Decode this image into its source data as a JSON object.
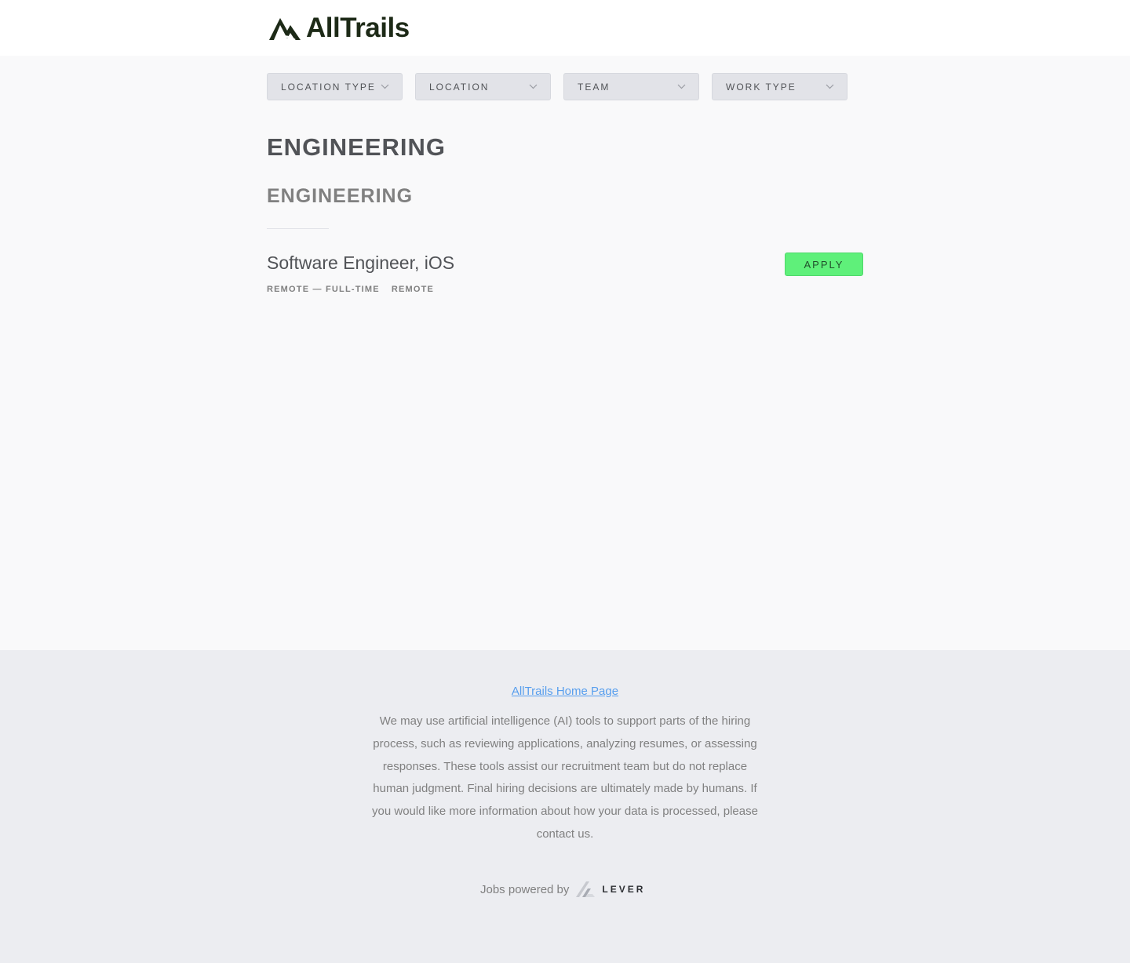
{
  "header": {
    "logo_text": "AllTrails",
    "logo_icon": "mountain-logo-icon",
    "logo_color": "#1d2a17"
  },
  "filters": [
    {
      "label": "LOCATION TYPE"
    },
    {
      "label": "LOCATION"
    },
    {
      "label": "TEAM"
    },
    {
      "label": "WORK TYPE"
    }
  ],
  "main": {
    "department": "ENGINEERING",
    "team": "ENGINEERING",
    "posting": {
      "title": "Software Engineer, iOS",
      "categories": [
        "REMOTE — FULL-TIME",
        "REMOTE"
      ],
      "apply_label": "APPLY",
      "apply_color": "#5ff07a"
    }
  },
  "footer": {
    "home_link": "AllTrails Home Page",
    "disclaimer": "We may use artificial intelligence (AI) tools to support parts of the hiring process, such as reviewing applications, analyzing resumes, or assessing responses. These tools assist our recruitment team but do not replace human judgment. Final hiring decisions are ultimately made by humans. If you would like more information about how your data is processed, please contact us.",
    "powered_by": "Jobs powered by",
    "lever_word": "LEVER",
    "link_color": "#579eee"
  }
}
